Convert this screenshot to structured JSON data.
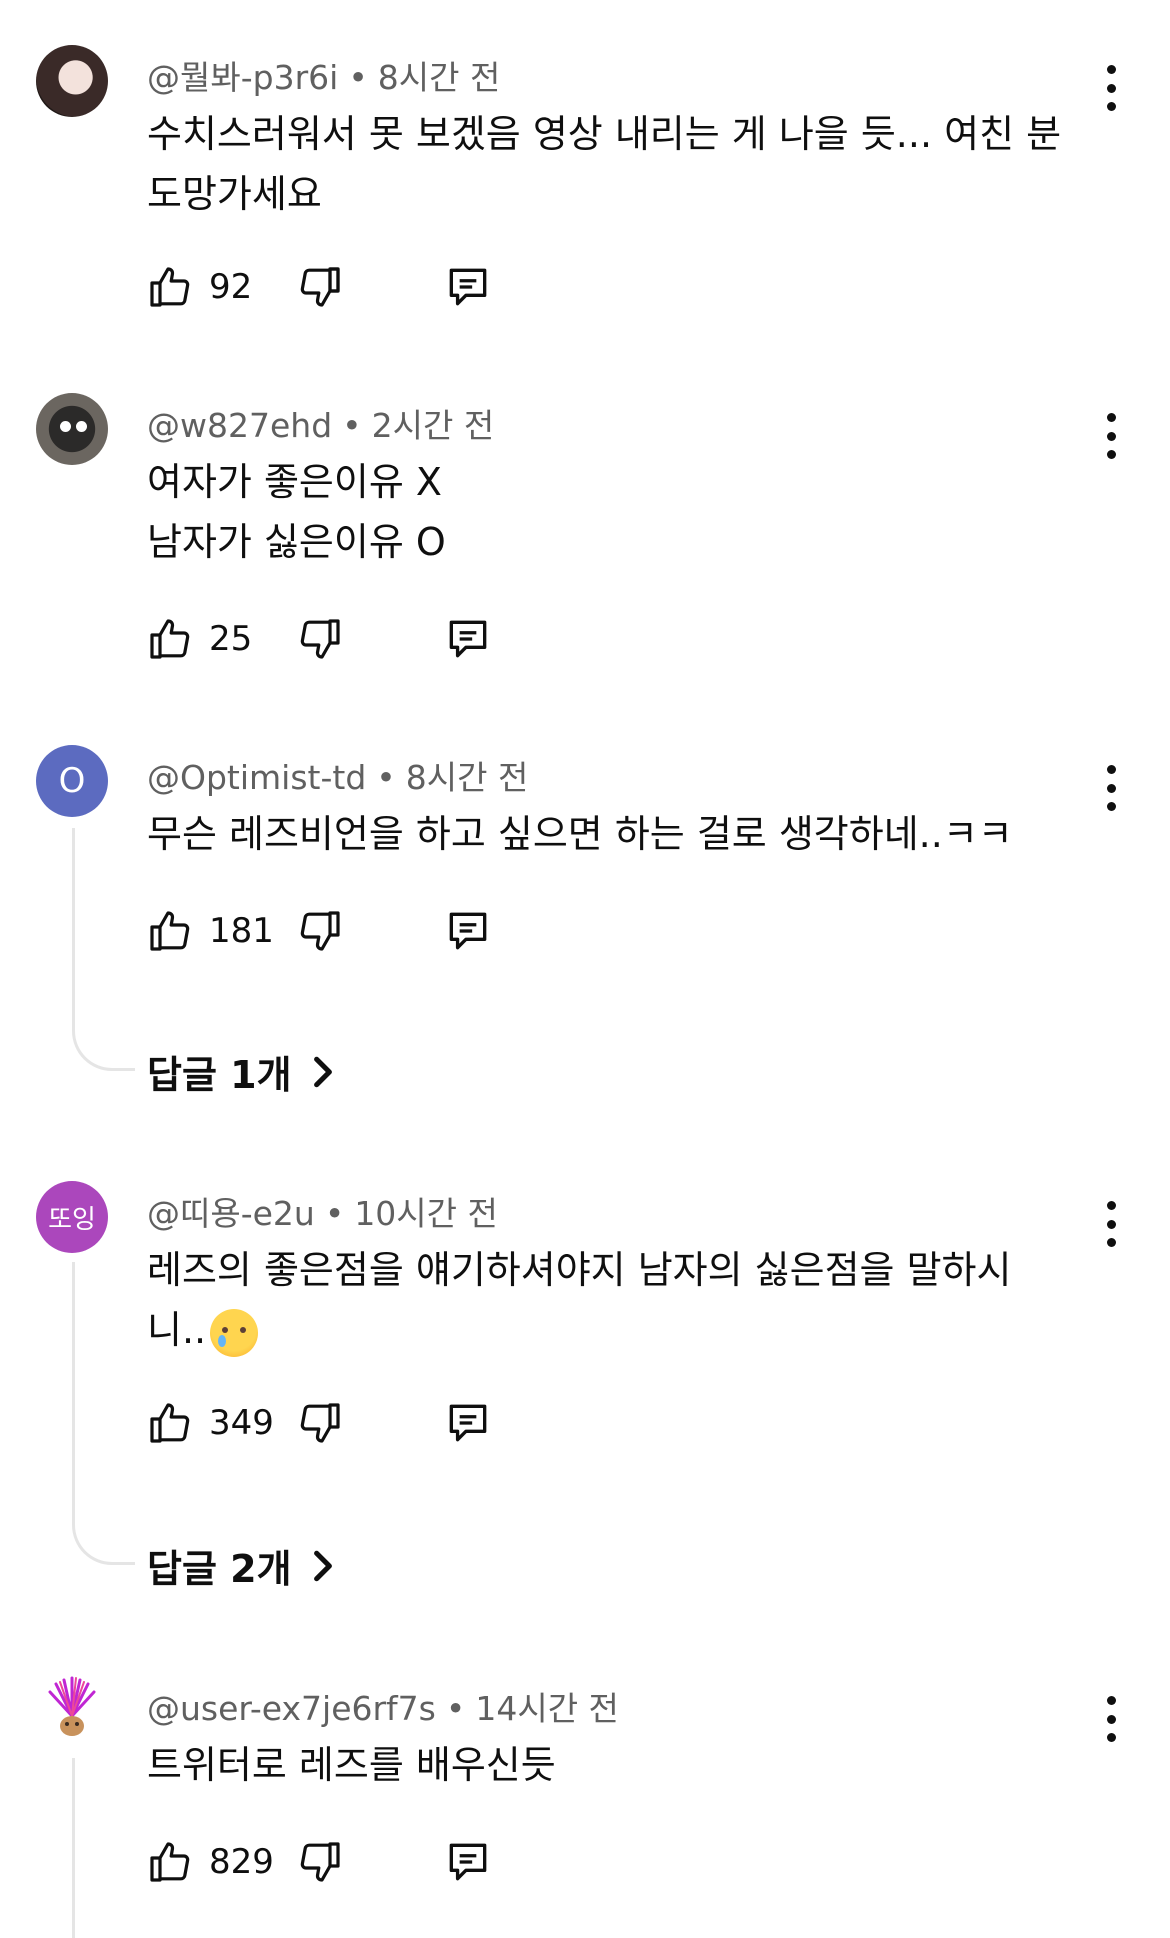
{
  "comments": [
    {
      "handle": "@뭘봐-p3r6i",
      "time": "8시간 전",
      "lines": [
        "수치스러워서 못 보겠음 영상 내리는 게 나을 듯... 여친 분",
        "도망가세요"
      ],
      "likes": "92"
    },
    {
      "handle": "@w827ehd",
      "time": "2시간 전",
      "lines": [
        "여자가 좋은이유 X",
        "남자가 싫은이유 O"
      ],
      "likes": "25"
    },
    {
      "avatar_text": "O",
      "handle": "@Optimist-td",
      "time": "8시간 전",
      "lines": [
        "무슨 레즈비언을 하고 싶으면 하는 걸로 생각하네..ㅋㅋ"
      ],
      "likes": "181",
      "replies": "답글 1개"
    },
    {
      "avatar_text": "또잉",
      "handle": "@띠용-e2u",
      "time": "10시간 전",
      "lines": [
        "레즈의 좋은점을 얘기하셔야지 남자의 싫은점을 말하시",
        "니.."
      ],
      "likes": "349",
      "replies": "답글 2개"
    },
    {
      "handle": "@user-ex7je6rf7s",
      "time": "14시간 전",
      "lines": [
        "트위터로 레즈를 배우신듯"
      ],
      "likes": "829"
    }
  ],
  "separator": "•",
  "icons": {
    "like": "thumbs-up-icon",
    "dislike": "thumbs-down-icon",
    "reply": "comment-icon",
    "menu": "more-vert-icon",
    "chevron": "chevron-right-icon"
  },
  "colors": {
    "avatar_o": "#5c6bc0",
    "avatar_text": "#ab47bc",
    "meta_text": "#606060"
  }
}
